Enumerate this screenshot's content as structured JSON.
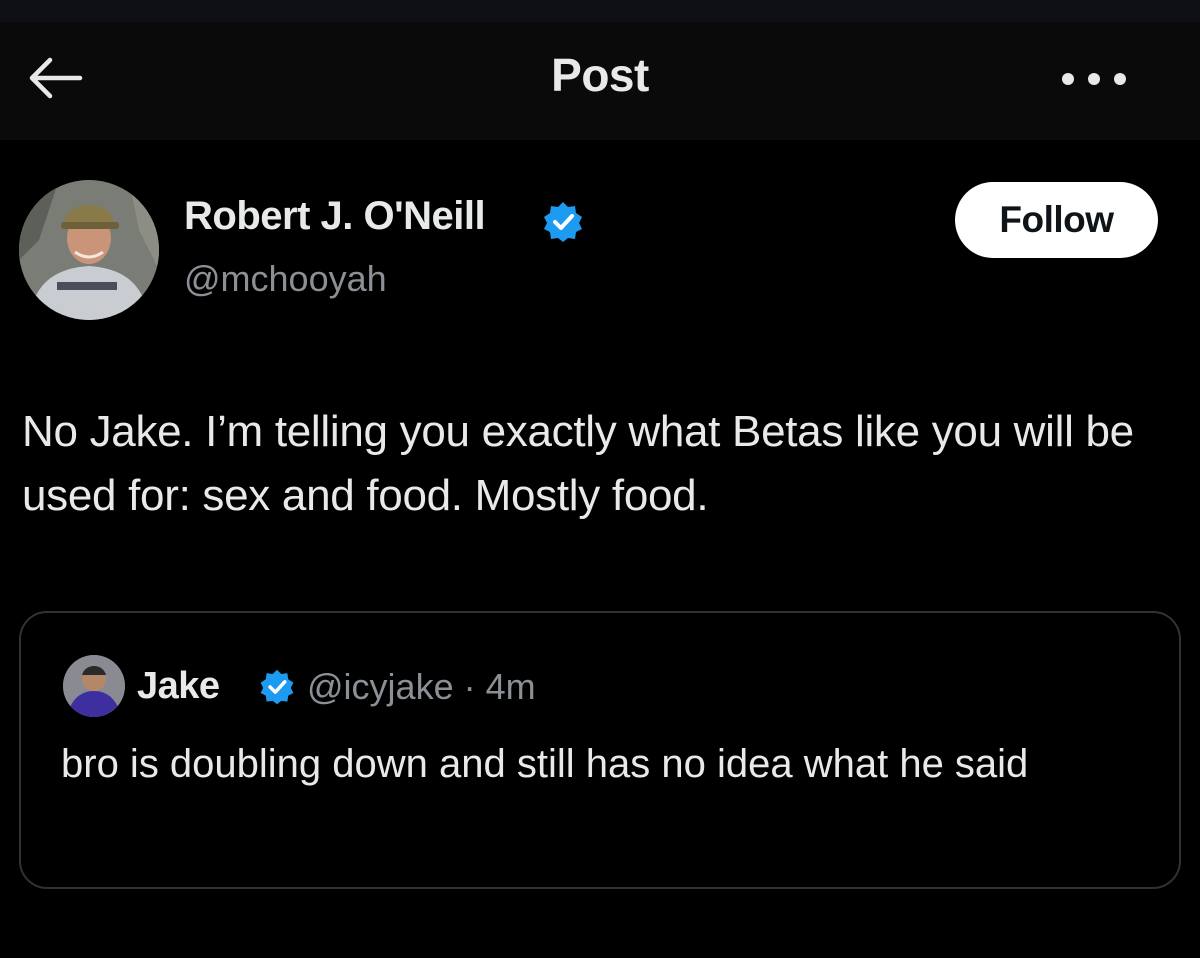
{
  "header": {
    "title": "Post",
    "back_icon": "arrow-left-icon",
    "more_icon": "more-horizontal-icon"
  },
  "post": {
    "author": {
      "name": "Robert J. O'Neill",
      "handle": "@mchooyah",
      "verified": true
    },
    "follow_label": "Follow",
    "text": "No Jake. I’m telling you exactly what Betas like you will be used for: sex and food. Mostly food."
  },
  "quoted_post": {
    "author": {
      "name": "Jake",
      "verified": true
    },
    "meta": "@icyjake · 4m",
    "text": "bro is doubling down and still has no idea what he said"
  },
  "colors": {
    "background": "#000000",
    "text_primary": "#e7e9ea",
    "text_secondary": "#8b9096",
    "verified_blue": "#1d9bf0",
    "follow_button_bg": "#ffffff",
    "card_border": "#2f3336"
  }
}
